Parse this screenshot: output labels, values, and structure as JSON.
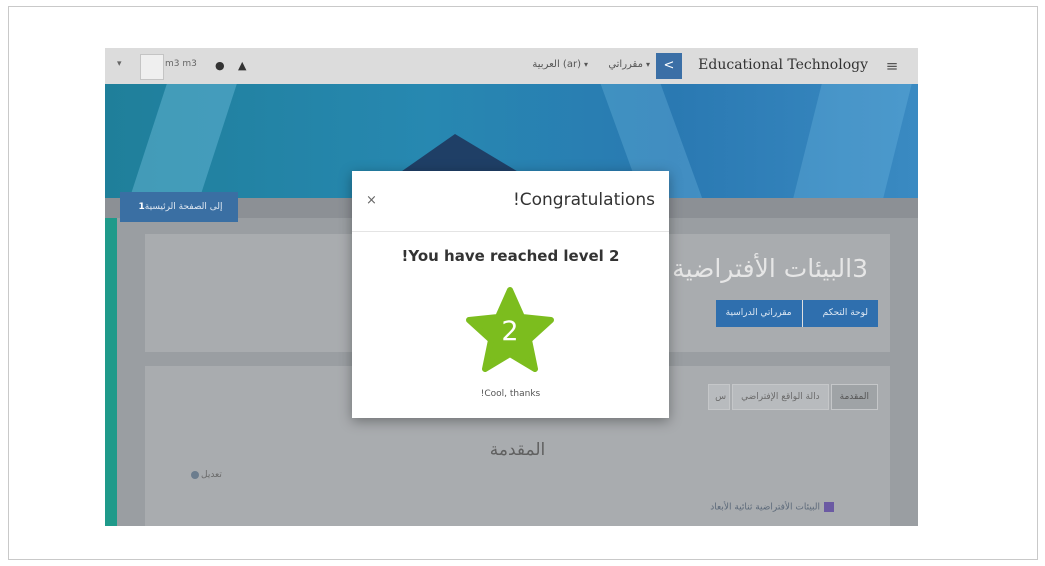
{
  "navbar": {
    "menu_icon": "hamburger-icon",
    "site_name": "Educational Technology",
    "share_icon": "share-icon",
    "courses_dropdown": "مقرراتي",
    "language_dropdown": "العربية (ar)",
    "notifications_icon": "bell-icon",
    "messages_icon": "chat-icon",
    "user_name": "m3 m3",
    "user_menu_caret": "▾"
  },
  "page": {
    "back_button_label": "إلى الصفحة الرئيسية",
    "back_button_number": "1",
    "course_title": "3البيئات الأفتراضية",
    "breadcrumb": [
      "لوحة التحكم",
      "مقرراتي الدراسية"
    ],
    "tabs": [
      "المقدمة",
      "دالة الواقع الإفتراضي",
      "س"
    ],
    "section_title": "المقدمة",
    "edit_link": "تعديل",
    "activity_link": "البيئات الأفتراضية ثنائية الأبعاد"
  },
  "modal": {
    "title": "!Congratulations",
    "close_label": "×",
    "heading": "!You have reached level 2",
    "level_number": "2",
    "level_badge_color": "#7cbd1e",
    "dismiss_link": "!Cool, thanks"
  }
}
